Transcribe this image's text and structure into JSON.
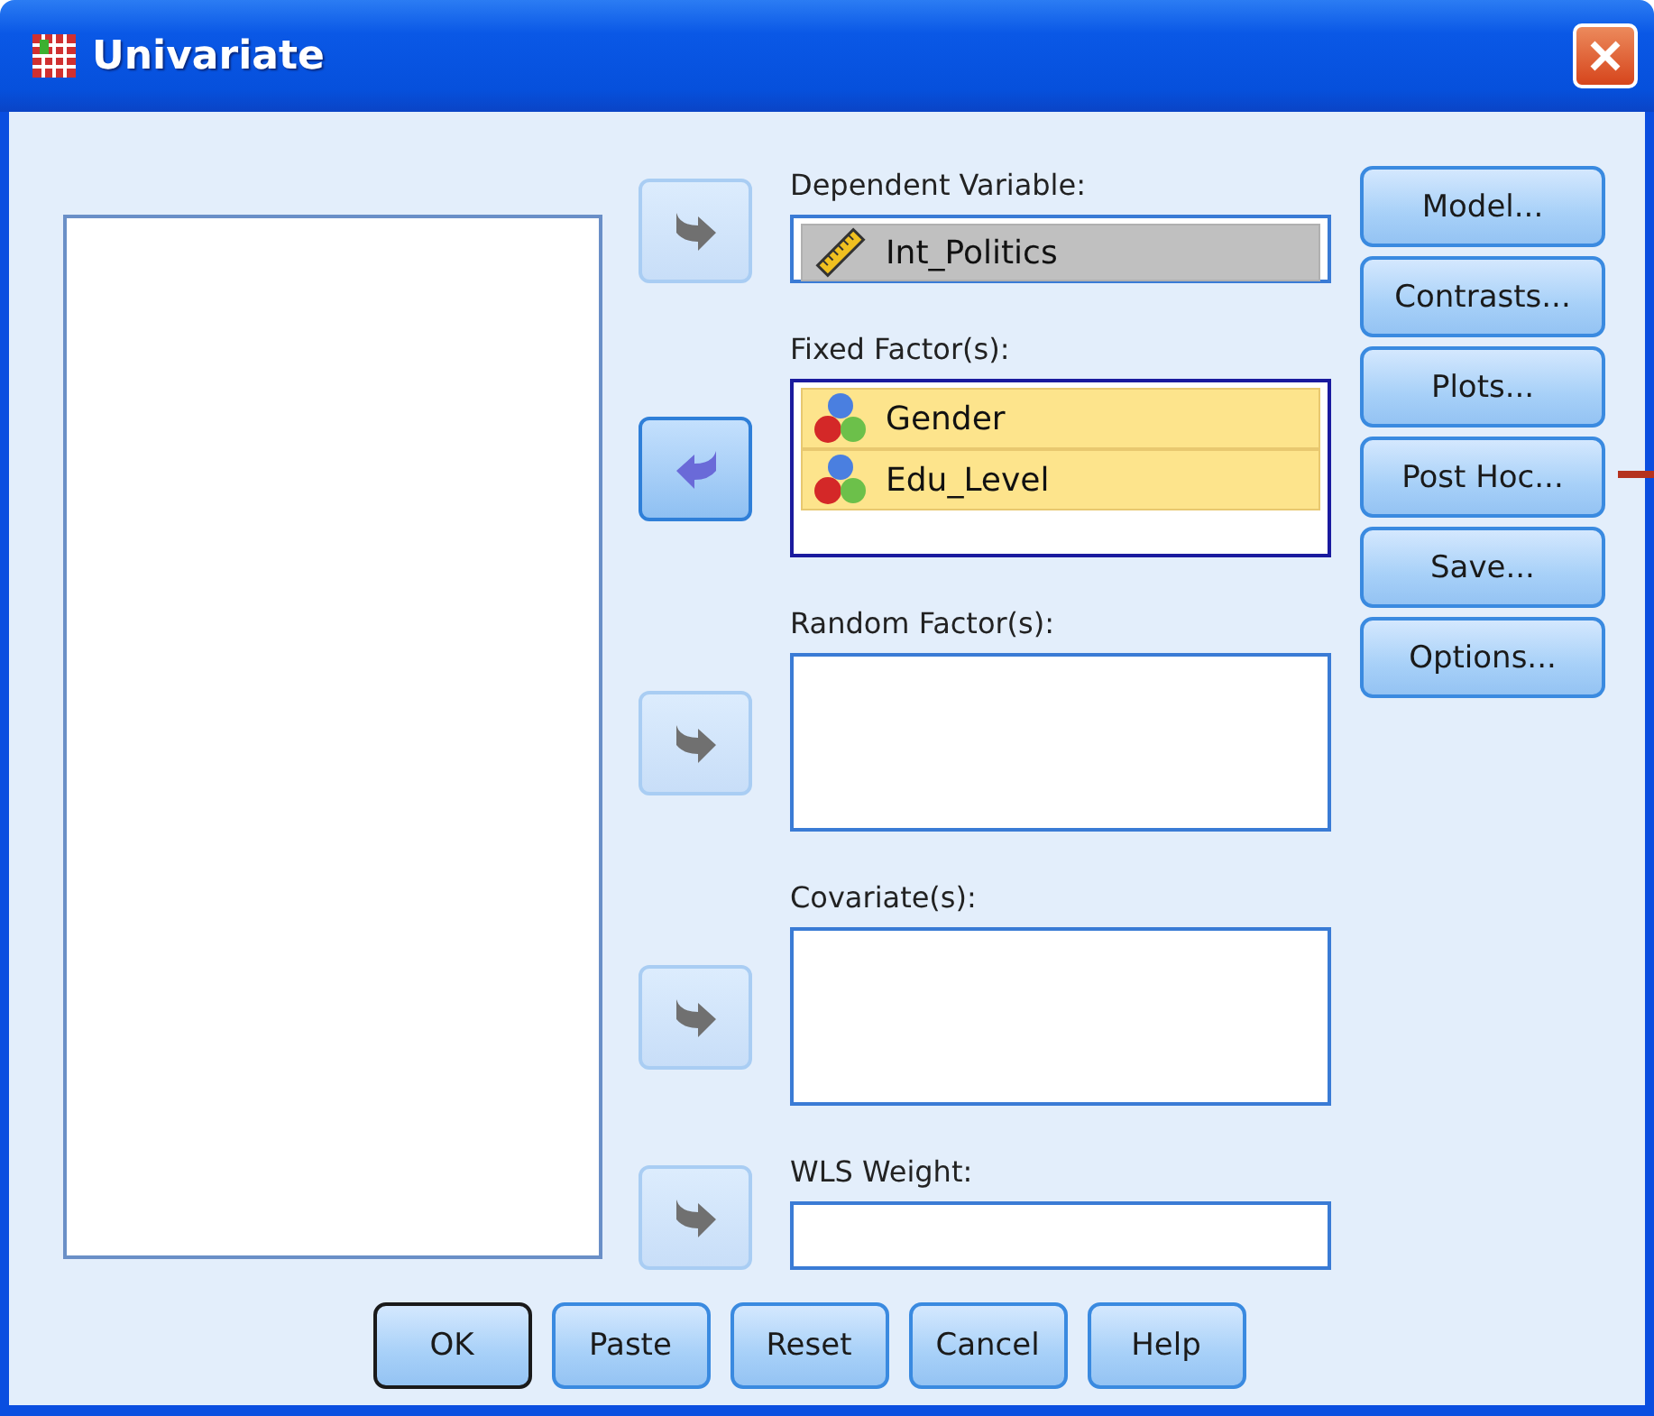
{
  "window": {
    "title": "Univariate"
  },
  "targets": [
    {
      "label": "Dependent Variable:",
      "kind": "single",
      "focused": false,
      "arrow": {
        "kind": "add",
        "disabled": true
      },
      "items": [
        {
          "name": "Int_Politics",
          "kind": "scale",
          "selected": true
        }
      ]
    },
    {
      "label": "Fixed Factor(s):",
      "kind": "list",
      "focused": true,
      "arrow": {
        "kind": "remove",
        "disabled": false
      },
      "items": [
        {
          "name": "Gender",
          "kind": "nominal",
          "selected": true
        },
        {
          "name": "Edu_Level",
          "kind": "nominal",
          "selected": true
        }
      ]
    },
    {
      "label": "Random Factor(s):",
      "kind": "list",
      "focused": false,
      "arrow": {
        "kind": "add",
        "disabled": true
      }
    },
    {
      "label": "Covariate(s):",
      "kind": "list",
      "focused": false,
      "arrow": {
        "kind": "add",
        "disabled": true
      }
    },
    {
      "label": "WLS Weight:",
      "kind": "single",
      "focused": false,
      "arrow": {
        "kind": "add",
        "disabled": true
      }
    }
  ],
  "side_buttons": [
    "Model...",
    "Contrasts...",
    "Plots...",
    "Post Hoc...",
    "Save...",
    "Options..."
  ],
  "bottom_buttons": [
    {
      "label": "OK",
      "default": true
    },
    {
      "label": "Paste",
      "default": false
    },
    {
      "label": "Reset",
      "default": false
    },
    {
      "label": "Cancel",
      "default": false
    },
    {
      "label": "Help",
      "default": false
    }
  ]
}
